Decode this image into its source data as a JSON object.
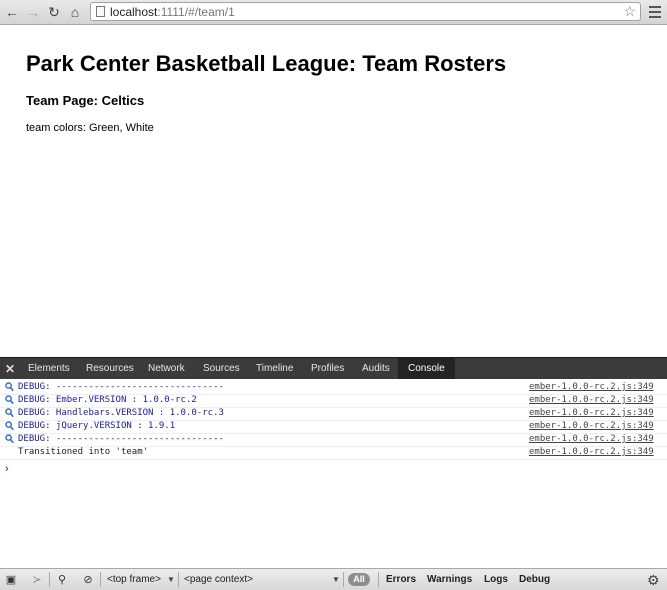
{
  "browser": {
    "url_host": "localhost",
    "url_path": ":1111/#/team/1",
    "icons": [
      "back-icon",
      "forward-icon",
      "reload-icon",
      "home-icon",
      "bookmark-star-icon",
      "menu-icon"
    ]
  },
  "page": {
    "title": "Park Center Basketball League: Team Rosters",
    "subtitle": "Team Page: Celtics",
    "colors_text": "team colors: Green, White"
  },
  "devtools": {
    "tabs": [
      "Elements",
      "Resources",
      "Network",
      "Sources",
      "Timeline",
      "Profiles",
      "Audits",
      "Console"
    ],
    "active_tab": "Console",
    "console": [
      {
        "message": "DEBUG: -------------------------------",
        "source": "ember-1.0.0-rc.2.js:349",
        "type": "debug"
      },
      {
        "message": "DEBUG: Ember.VERSION : 1.0.0-rc.2",
        "source": "ember-1.0.0-rc.2.js:349",
        "type": "debug"
      },
      {
        "message": "DEBUG: Handlebars.VERSION : 1.0.0-rc.3",
        "source": "ember-1.0.0-rc.2.js:349",
        "type": "debug"
      },
      {
        "message": "DEBUG: jQuery.VERSION : 1.9.1",
        "source": "ember-1.0.0-rc.2.js:349",
        "type": "debug"
      },
      {
        "message": "DEBUG: -------------------------------",
        "source": "ember-1.0.0-rc.2.js:349",
        "type": "debug"
      },
      {
        "message": "Transitioned into 'team'",
        "source": "ember-1.0.0-rc.2.js:349",
        "type": "log"
      }
    ],
    "prompt_symbol": "›",
    "status_bar": {
      "frame_select": "<top frame>",
      "context_select": "<page context>",
      "filter_all": "All",
      "filters": [
        "Errors",
        "Warnings",
        "Logs",
        "Debug"
      ]
    }
  },
  "colors": {
    "devtools_tab_bg": "#3b3b3b",
    "debug_text": "#1a1aa6",
    "prompt": "#2b6ad8"
  }
}
